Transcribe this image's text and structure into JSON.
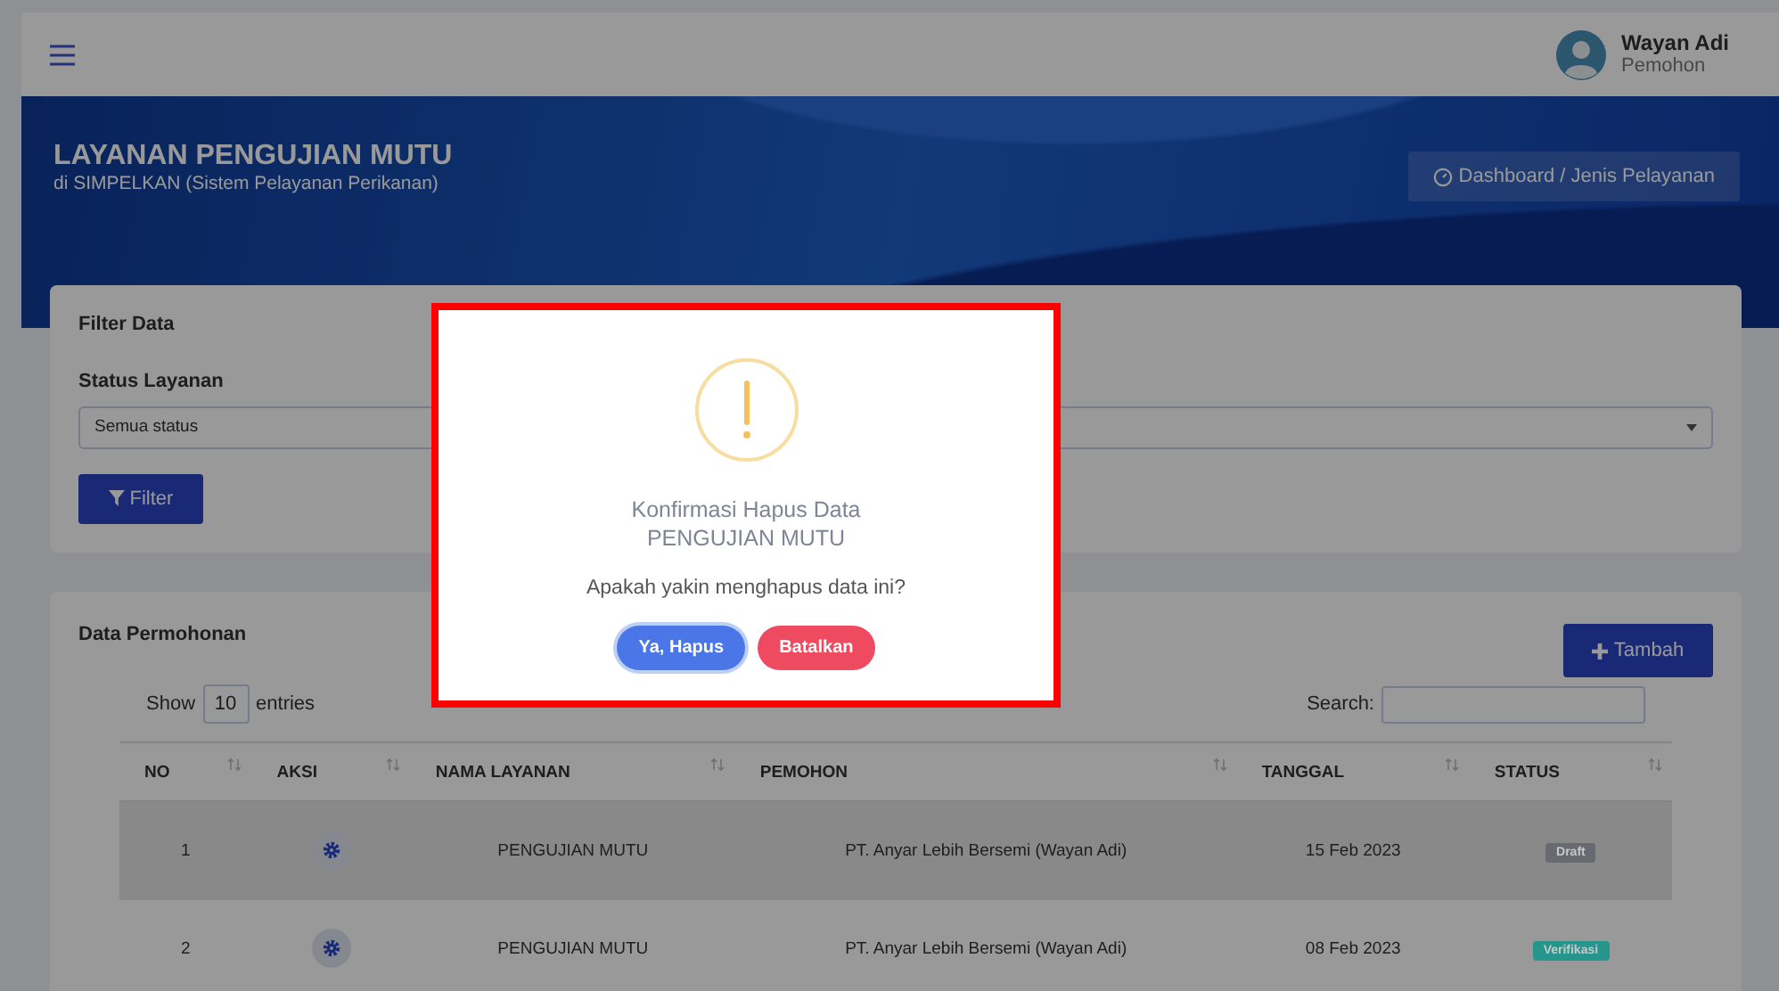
{
  "topbar": {
    "user_name": "Wayan Adi",
    "user_role": "Pemohon"
  },
  "header": {
    "title": "LAYANAN PENGUJIAN MUTU",
    "subtitle": "di SIMPELKAN (Sistem Pelayanan Perikanan)",
    "breadcrumb": "Dashboard / Jenis Pelayanan"
  },
  "filter": {
    "title": "Filter Data",
    "label": "Status Layanan",
    "value": "Semua status",
    "button": "Filter"
  },
  "data": {
    "title": "Data Permohonan",
    "add_button": "Tambah",
    "show_label": "Show",
    "entries_value": "10",
    "entries_label": "entries",
    "search_label": "Search:",
    "columns": [
      "NO",
      "AKSI",
      "NAMA LAYANAN",
      "PEMOHON",
      "TANGGAL",
      "STATUS"
    ],
    "rows": [
      {
        "no": "1",
        "service": "PENGUJIAN MUTU",
        "applicant": "PT. Anyar Lebih Bersemi (Wayan Adi)",
        "date": "15 Feb 2023",
        "status": "Draft",
        "color": "#676a70",
        "highlighted": true
      },
      {
        "no": "2",
        "service": "PENGUJIAN MUTU",
        "applicant": "PT. Anyar Lebih Bersemi (Wayan Adi)",
        "date": "08 Feb 2023",
        "status": "Verifikasi",
        "color": "#26958c",
        "highlighted": false
      }
    ]
  },
  "dialog": {
    "title": "Konfirmasi Hapus Data",
    "subtitle": "PENGUJIAN MUTU",
    "message": "Apakah yakin menghapus data ini?",
    "confirm": "Ya, Hapus",
    "cancel": "Batalkan"
  }
}
